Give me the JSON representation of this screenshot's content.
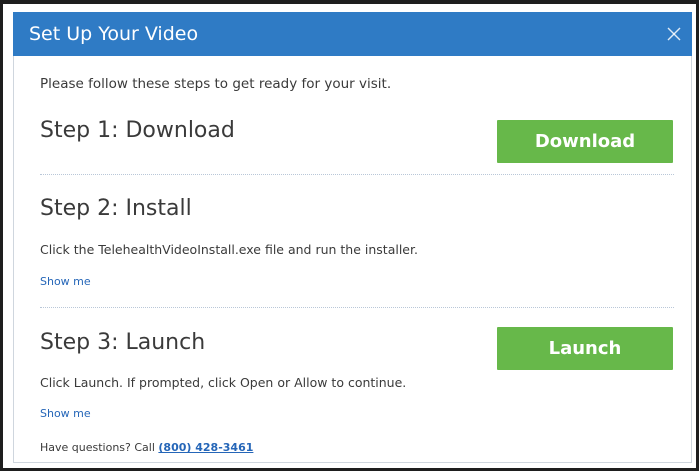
{
  "dialog": {
    "title": "Set Up Your Video",
    "close_icon": "close-icon",
    "intro": "Please follow these steps to get ready for your visit.",
    "steps": [
      {
        "heading": "Step 1: Download",
        "button_label": "Download"
      },
      {
        "heading": "Step 2: Install",
        "description": "Click the TelehealthVideoInstall.exe file and run the installer.",
        "show_me": "Show me"
      },
      {
        "heading": "Step 3: Launch",
        "description": "Click Launch. If prompted, click Open or Allow to continue.",
        "show_me": "Show me",
        "button_label": "Launch"
      }
    ],
    "help_prefix": "Have questions? Call ",
    "help_phone": "(800) 428-3461"
  },
  "colors": {
    "titlebar": "#2f7bc5",
    "button": "#67b84a",
    "link": "#2566b8"
  }
}
